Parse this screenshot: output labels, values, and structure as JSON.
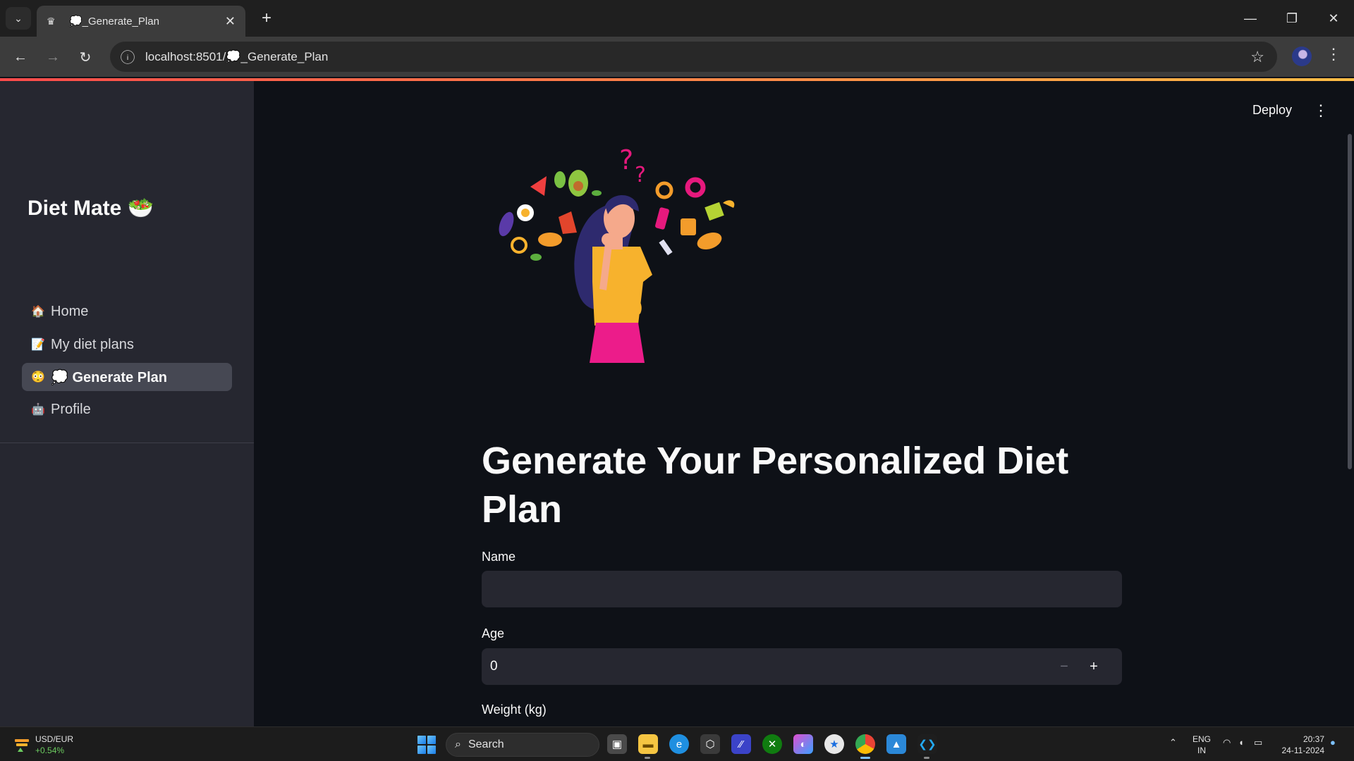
{
  "browser": {
    "tab_title": "💭_Generate_Plan",
    "url": "localhost:8501/💭_Generate_Plan"
  },
  "sidebar": {
    "app_title": "Diet Mate 🥗",
    "items": [
      {
        "icon": "🏠",
        "label": "Home"
      },
      {
        "icon": "📝",
        "label": "My diet plans"
      },
      {
        "icon": "😳",
        "label": "💭 Generate Plan",
        "active": true
      },
      {
        "icon": "🤖",
        "label": "Profile"
      }
    ]
  },
  "header": {
    "deploy_label": "Deploy"
  },
  "main": {
    "title": "Generate Your Personalized Diet Plan",
    "fields": {
      "name_label": "Name",
      "name_value": "",
      "age_label": "Age",
      "age_value": "0",
      "weight_label": "Weight (kg)"
    },
    "stepper": {
      "minus": "−",
      "plus": "+"
    }
  },
  "taskbar": {
    "ticker_pair": "USD/EUR",
    "ticker_change": "+0.54%",
    "search_label": "Search",
    "lang_1": "ENG",
    "lang_2": "IN",
    "time": "20:37",
    "date": "24-11-2024"
  },
  "colors": {
    "accent_start": "#ff4b4b",
    "accent_end": "#ffbd45",
    "sidebar_bg": "#262730",
    "main_bg": "#0e1117"
  }
}
